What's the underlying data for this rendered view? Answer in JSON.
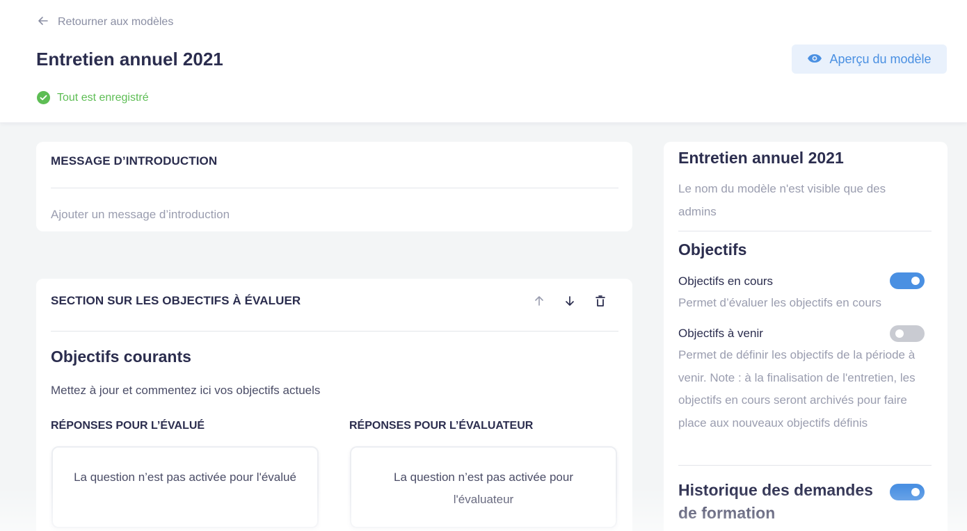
{
  "header": {
    "back_label": "Retourner aux modèles",
    "title": "Entretien annuel 2021",
    "save_status": "Tout est enregistré",
    "preview_label": "Aperçu du modèle"
  },
  "intro": {
    "heading": "MESSAGE D’INTRODUCTION",
    "placeholder": "Ajouter un message d’introduction"
  },
  "section": {
    "heading": "SECTION SUR LES OBJECTIFS À ÉVALUER",
    "subtitle": "Objectifs courants",
    "description": "Mettez à jour et commentez ici vos objectifs actuels",
    "columns": [
      {
        "heading": "RÉPONSES POUR L’ÉVALUÉ",
        "message": "La question n’est pas activée pour l'évalué"
      },
      {
        "heading": "RÉPONSES POUR L’ÉVALUATEUR",
        "message": "La question n’est pas activée pour l'évaluateur"
      }
    ]
  },
  "sidebar": {
    "title": "Entretien annuel 2021",
    "subtitle": "Le nom du modèle n'est visible que des admins",
    "objectives_title": "Objectifs",
    "toggles": [
      {
        "label": "Objectifs en cours",
        "description": "Permet d’évaluer les objectifs en cours",
        "on": true
      },
      {
        "label": "Objectifs à venir",
        "description": "Permet de définir les objectifs de la période à venir. Note : à la finalisation de l'entretien, les objectifs en cours seront archivés pour faire place aux nouveaux objectifs définis",
        "on": false
      }
    ],
    "training_title": "Historique des demandes de formation",
    "training_on": true
  },
  "colors": {
    "accent": "#4a90e2",
    "success": "#5dbd54",
    "text": "#2b2d4e",
    "muted": "#9a9daf",
    "background": "#f3f5f6"
  },
  "icons": [
    "arrow-left-icon",
    "check-circle-icon",
    "eye-icon",
    "arrow-up-icon",
    "arrow-down-icon",
    "trash-icon"
  ]
}
